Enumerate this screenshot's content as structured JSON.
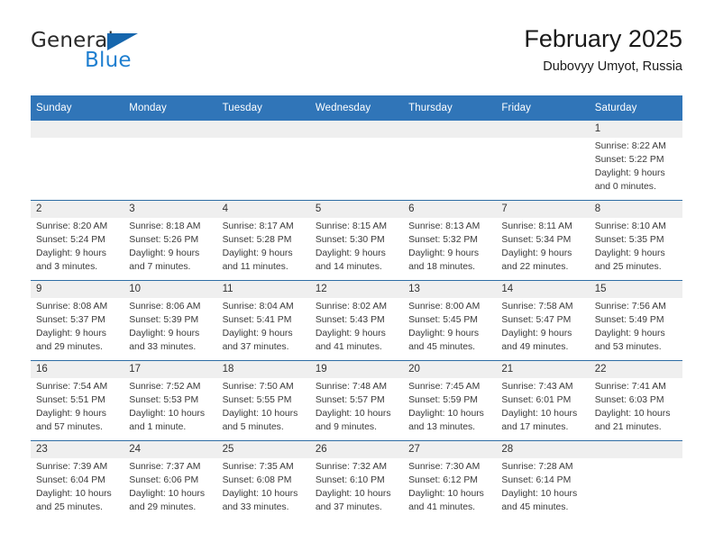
{
  "brand": {
    "name_top": "General",
    "name_bottom": "Blue",
    "triangle_color": "#1666ad",
    "blue_color": "#1f7fd0"
  },
  "header": {
    "title": "February 2025",
    "subtitle": "Dubovyy Umyot, Russia"
  },
  "theme": {
    "header_blue": "#3075b8",
    "row_divider": "#2e6da4",
    "daynum_band": "#efefef"
  },
  "calendar": {
    "weekday_headers": [
      "Sunday",
      "Monday",
      "Tuesday",
      "Wednesday",
      "Thursday",
      "Friday",
      "Saturday"
    ],
    "weeks": [
      [
        {
          "day": "",
          "lines": []
        },
        {
          "day": "",
          "lines": []
        },
        {
          "day": "",
          "lines": []
        },
        {
          "day": "",
          "lines": []
        },
        {
          "day": "",
          "lines": []
        },
        {
          "day": "",
          "lines": []
        },
        {
          "day": "1",
          "lines": [
            "Sunrise: 8:22 AM",
            "Sunset: 5:22 PM",
            "Daylight: 9 hours",
            "and 0 minutes."
          ]
        }
      ],
      [
        {
          "day": "2",
          "lines": [
            "Sunrise: 8:20 AM",
            "Sunset: 5:24 PM",
            "Daylight: 9 hours",
            "and 3 minutes."
          ]
        },
        {
          "day": "3",
          "lines": [
            "Sunrise: 8:18 AM",
            "Sunset: 5:26 PM",
            "Daylight: 9 hours",
            "and 7 minutes."
          ]
        },
        {
          "day": "4",
          "lines": [
            "Sunrise: 8:17 AM",
            "Sunset: 5:28 PM",
            "Daylight: 9 hours",
            "and 11 minutes."
          ]
        },
        {
          "day": "5",
          "lines": [
            "Sunrise: 8:15 AM",
            "Sunset: 5:30 PM",
            "Daylight: 9 hours",
            "and 14 minutes."
          ]
        },
        {
          "day": "6",
          "lines": [
            "Sunrise: 8:13 AM",
            "Sunset: 5:32 PM",
            "Daylight: 9 hours",
            "and 18 minutes."
          ]
        },
        {
          "day": "7",
          "lines": [
            "Sunrise: 8:11 AM",
            "Sunset: 5:34 PM",
            "Daylight: 9 hours",
            "and 22 minutes."
          ]
        },
        {
          "day": "8",
          "lines": [
            "Sunrise: 8:10 AM",
            "Sunset: 5:35 PM",
            "Daylight: 9 hours",
            "and 25 minutes."
          ]
        }
      ],
      [
        {
          "day": "9",
          "lines": [
            "Sunrise: 8:08 AM",
            "Sunset: 5:37 PM",
            "Daylight: 9 hours",
            "and 29 minutes."
          ]
        },
        {
          "day": "10",
          "lines": [
            "Sunrise: 8:06 AM",
            "Sunset: 5:39 PM",
            "Daylight: 9 hours",
            "and 33 minutes."
          ]
        },
        {
          "day": "11",
          "lines": [
            "Sunrise: 8:04 AM",
            "Sunset: 5:41 PM",
            "Daylight: 9 hours",
            "and 37 minutes."
          ]
        },
        {
          "day": "12",
          "lines": [
            "Sunrise: 8:02 AM",
            "Sunset: 5:43 PM",
            "Daylight: 9 hours",
            "and 41 minutes."
          ]
        },
        {
          "day": "13",
          "lines": [
            "Sunrise: 8:00 AM",
            "Sunset: 5:45 PM",
            "Daylight: 9 hours",
            "and 45 minutes."
          ]
        },
        {
          "day": "14",
          "lines": [
            "Sunrise: 7:58 AM",
            "Sunset: 5:47 PM",
            "Daylight: 9 hours",
            "and 49 minutes."
          ]
        },
        {
          "day": "15",
          "lines": [
            "Sunrise: 7:56 AM",
            "Sunset: 5:49 PM",
            "Daylight: 9 hours",
            "and 53 minutes."
          ]
        }
      ],
      [
        {
          "day": "16",
          "lines": [
            "Sunrise: 7:54 AM",
            "Sunset: 5:51 PM",
            "Daylight: 9 hours",
            "and 57 minutes."
          ]
        },
        {
          "day": "17",
          "lines": [
            "Sunrise: 7:52 AM",
            "Sunset: 5:53 PM",
            "Daylight: 10 hours",
            "and 1 minute."
          ]
        },
        {
          "day": "18",
          "lines": [
            "Sunrise: 7:50 AM",
            "Sunset: 5:55 PM",
            "Daylight: 10 hours",
            "and 5 minutes."
          ]
        },
        {
          "day": "19",
          "lines": [
            "Sunrise: 7:48 AM",
            "Sunset: 5:57 PM",
            "Daylight: 10 hours",
            "and 9 minutes."
          ]
        },
        {
          "day": "20",
          "lines": [
            "Sunrise: 7:45 AM",
            "Sunset: 5:59 PM",
            "Daylight: 10 hours",
            "and 13 minutes."
          ]
        },
        {
          "day": "21",
          "lines": [
            "Sunrise: 7:43 AM",
            "Sunset: 6:01 PM",
            "Daylight: 10 hours",
            "and 17 minutes."
          ]
        },
        {
          "day": "22",
          "lines": [
            "Sunrise: 7:41 AM",
            "Sunset: 6:03 PM",
            "Daylight: 10 hours",
            "and 21 minutes."
          ]
        }
      ],
      [
        {
          "day": "23",
          "lines": [
            "Sunrise: 7:39 AM",
            "Sunset: 6:04 PM",
            "Daylight: 10 hours",
            "and 25 minutes."
          ]
        },
        {
          "day": "24",
          "lines": [
            "Sunrise: 7:37 AM",
            "Sunset: 6:06 PM",
            "Daylight: 10 hours",
            "and 29 minutes."
          ]
        },
        {
          "day": "25",
          "lines": [
            "Sunrise: 7:35 AM",
            "Sunset: 6:08 PM",
            "Daylight: 10 hours",
            "and 33 minutes."
          ]
        },
        {
          "day": "26",
          "lines": [
            "Sunrise: 7:32 AM",
            "Sunset: 6:10 PM",
            "Daylight: 10 hours",
            "and 37 minutes."
          ]
        },
        {
          "day": "27",
          "lines": [
            "Sunrise: 7:30 AM",
            "Sunset: 6:12 PM",
            "Daylight: 10 hours",
            "and 41 minutes."
          ]
        },
        {
          "day": "28",
          "lines": [
            "Sunrise: 7:28 AM",
            "Sunset: 6:14 PM",
            "Daylight: 10 hours",
            "and 45 minutes."
          ]
        },
        {
          "day": "",
          "lines": []
        }
      ]
    ]
  }
}
